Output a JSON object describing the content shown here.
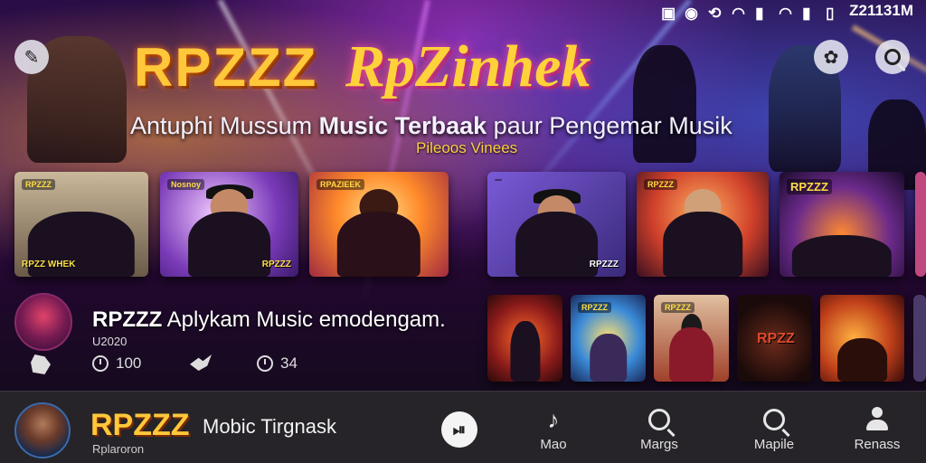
{
  "status": {
    "time": "Z21131M",
    "icons": [
      "notification-icon",
      "location-icon",
      "sync-icon",
      "wifi-icon",
      "signal-icon",
      "wifi-icon",
      "signal-icon",
      "battery-icon"
    ]
  },
  "header": {
    "logo_left": "RPZZZ",
    "logo_center": "RpZinhek",
    "tagline_pre": "Antuphi Mussum ",
    "tagline_bold": "Music Terbaak",
    "tagline_post": " paur Pengemar Musik",
    "subtitle": "Pileoos Vinees"
  },
  "cards_top": [
    {
      "badge": "RPZZZ",
      "title": "RPZZ WHEK"
    },
    {
      "badge": "Nosnoy",
      "title": "RPZZZ"
    },
    {
      "badge": "RPAZIEEK",
      "title": ""
    },
    {
      "badge": "",
      "title": "RPZZZ"
    },
    {
      "badge": "RPZZZ",
      "title": ""
    },
    {
      "badge": "RPZZZ",
      "title": ""
    },
    {
      "badge": "",
      "title": ""
    }
  ],
  "cards_bottom": [
    {
      "badge": "",
      "title": ""
    },
    {
      "badge": "RPZZZ",
      "title": ""
    },
    {
      "badge": "RPZZZ",
      "title": ""
    },
    {
      "badge": "",
      "title": "RPZZ"
    },
    {
      "badge": "",
      "title": ""
    },
    {
      "badge": "",
      "title": ""
    }
  ],
  "now_playing": {
    "title_bold": "RPZZZ",
    "title_rest": " Aplykam Music emodengam.",
    "subtitle": "U2020",
    "plays": "100",
    "duration": "34"
  },
  "bottom_nav": {
    "brand": "RPZZZ",
    "brand_sub": "Rplaroron",
    "track_title": "Mobic Tirgnask",
    "items": [
      {
        "label": "Mao",
        "icon": "music-note-icon"
      },
      {
        "label": "Margs",
        "icon": "search-icon"
      },
      {
        "label": "Mapile",
        "icon": "search-icon"
      },
      {
        "label": "Renass",
        "icon": "profile-icon"
      }
    ]
  },
  "colors": {
    "brand_gold": "#ffc83a",
    "accent_pink": "#d44aff",
    "nav_bg": "#262428"
  }
}
